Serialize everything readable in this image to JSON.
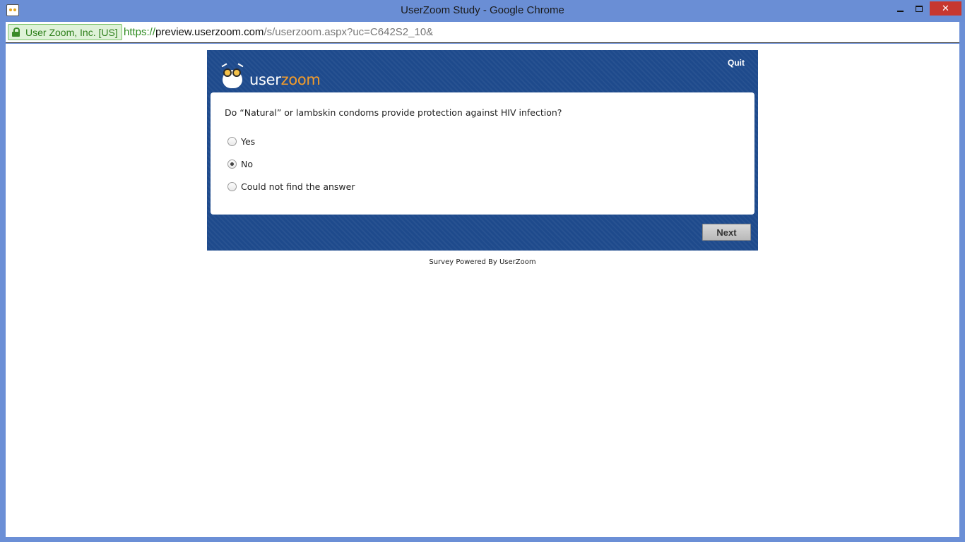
{
  "window": {
    "title": "UserZoom Study - Google Chrome",
    "close_glyph": "✕"
  },
  "address_bar": {
    "ev_label": "User Zoom, Inc. [US]",
    "url_scheme": "https://",
    "url_host": "preview.userzoom.com",
    "url_path": "/s/userzoom.aspx?uc=C642S2_10&"
  },
  "survey": {
    "brand_part1": "user",
    "brand_part2": "zoom",
    "quit_label": "Quit",
    "question": "Do “Natural” or lambskin condoms provide protection against HIV infection?",
    "options": [
      {
        "label": "Yes",
        "selected": false
      },
      {
        "label": "No",
        "selected": true
      },
      {
        "label": "Could not find the answer",
        "selected": false
      }
    ],
    "next_label": "Next",
    "footer": "Survey Powered By UserZoom"
  },
  "colors": {
    "survey_bg": "#1e4a8c",
    "brand_accent": "#f39c2b",
    "window_frame": "#6b8fd6",
    "close_button": "#c7372f",
    "ev_green": "#2d7f1a"
  }
}
